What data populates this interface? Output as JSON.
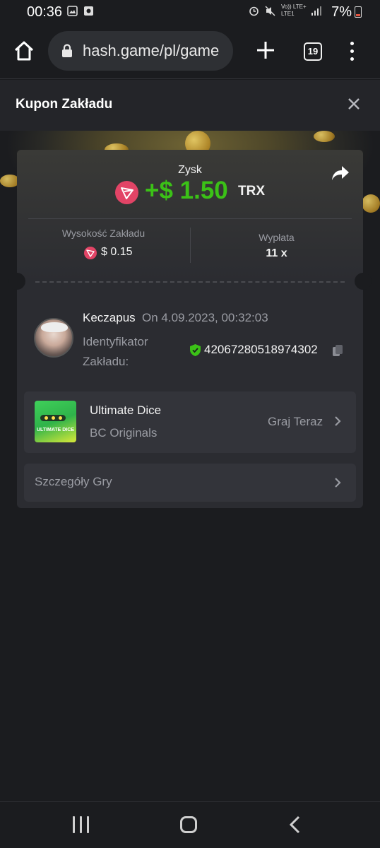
{
  "status_bar": {
    "time": "00:36",
    "battery_text": "7%",
    "net_label_top": "Vo)) LTE+",
    "net_label_bottom": "LTE1"
  },
  "browser": {
    "url": "hash.game/pl/game",
    "tab_count": "19"
  },
  "panel": {
    "title": "Kupon Zakładu"
  },
  "result": {
    "profit_label": "Zysk",
    "profit_value": "+$ 1.50",
    "profit_currency": "TRX",
    "bet_amount_label": "Wysokość Zakładu",
    "bet_amount_value": "$ 0.15",
    "payout_label": "Wypłata",
    "payout_value": "11 x"
  },
  "bet": {
    "username": "Keczapus",
    "date": "On 4.09.2023, 00:32:03",
    "id_label": "Identyfikator Zakładu:",
    "id_value": "42067280518974302"
  },
  "game": {
    "name": "Ultimate Dice",
    "provider": "BC Originals",
    "play_label": "Graj Teraz",
    "thumb_caption": "ULTIMATE DICE"
  },
  "details": {
    "label": "Szczegóły Gry"
  },
  "colors": {
    "profit_green": "#3bc117",
    "trx_red": "#e24466",
    "background": "#1b1c1f",
    "card": "#2b2c31"
  }
}
